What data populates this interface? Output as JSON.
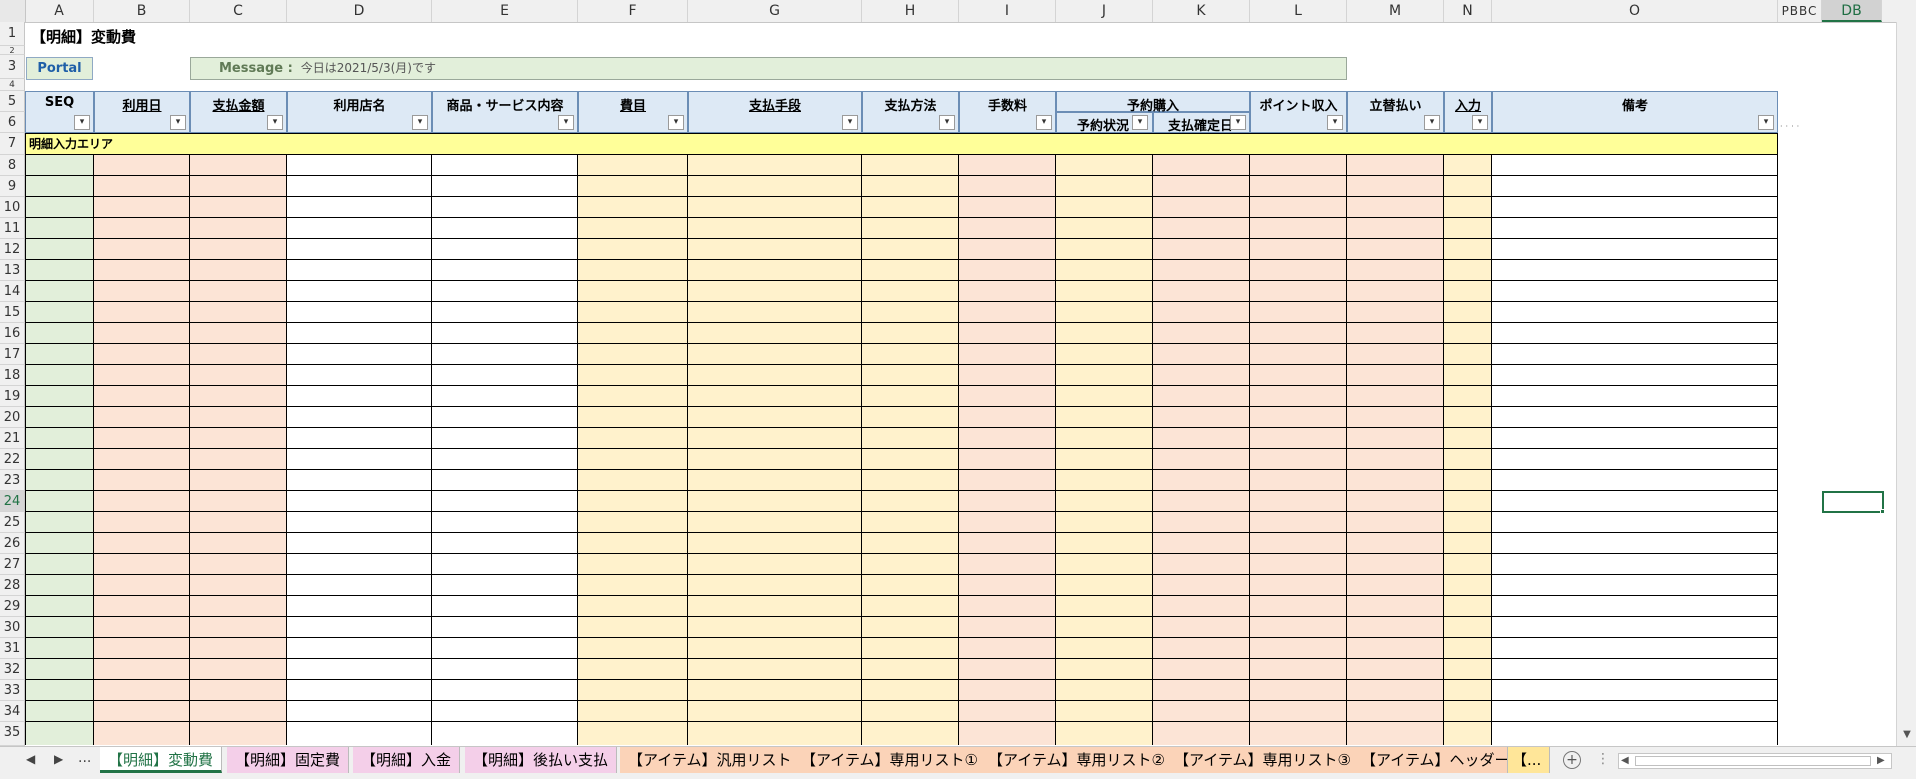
{
  "title": "【明細】変動費",
  "portal_label": "Portal",
  "message": {
    "label": "Message :",
    "text": "今日は2021/5/3(月)です"
  },
  "column_letters": [
    "A",
    "B",
    "C",
    "D",
    "E",
    "F",
    "G",
    "H",
    "I",
    "J",
    "K",
    "L",
    "M",
    "N",
    "O"
  ],
  "far_column_letters": "PBBC",
  "selected_column_letter": "DB",
  "headers": {
    "seq": "SEQ",
    "date": "利用日",
    "amount": "支払金額",
    "store": "利用店名",
    "item": "商品・サービス内容",
    "category": "費目",
    "method_type": "支払手段",
    "method": "支払方法",
    "fee": "手数料",
    "reservation": "予約購入",
    "reservation_status": "予約状況",
    "payment_date": "支払確定日",
    "points": "ポイント収入",
    "advance": "立替払い",
    "input": "入力",
    "notes": "備考"
  },
  "section_label": "明細入力エリア",
  "row_numbers": [
    "1",
    "2",
    "3",
    "4",
    "5",
    "6",
    "7",
    "8",
    "9",
    "10",
    "11",
    "12",
    "13",
    "14",
    "15",
    "16",
    "17",
    "18",
    "19",
    "20",
    "21",
    "22",
    "23",
    "24",
    "25",
    "26",
    "27",
    "28",
    "29",
    "30",
    "31",
    "32",
    "33",
    "34",
    "35"
  ],
  "selected_row": "24",
  "sheet_tabs": [
    {
      "label": "【明細】変動費",
      "active": true
    },
    {
      "label": "【明細】固定費"
    },
    {
      "label": "【明細】入金"
    },
    {
      "label": "【明細】後払い支払"
    },
    {
      "label": "【アイテム】汎用リスト"
    },
    {
      "label": "【アイテム】専用リスト①"
    },
    {
      "label": "【アイテム】専用リスト②"
    },
    {
      "label": "【アイテム】専用リスト③"
    },
    {
      "label": "【アイテム】ヘッダー"
    },
    {
      "label": "【..."
    }
  ],
  "tab_overflow": "...",
  "colors": {
    "green": "#e2efda",
    "pink": "#fce4d6",
    "yellow": "#fff2cc",
    "header": "#dde9f5",
    "section": "#ffff99",
    "accent": "#217346"
  }
}
